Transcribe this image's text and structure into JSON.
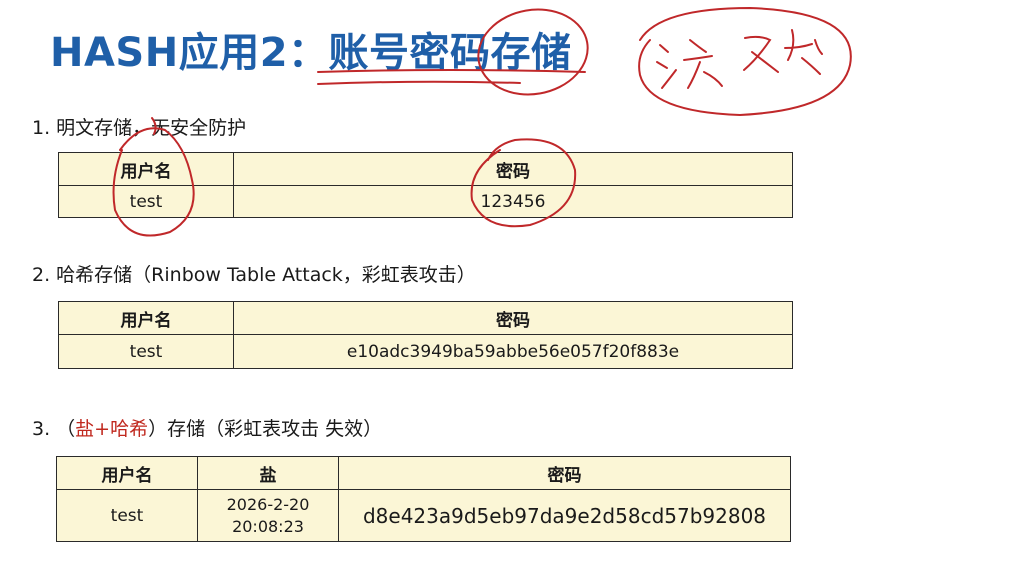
{
  "title": "HASH应用2：账号密码存储",
  "handwriting": "游戏",
  "sections": [
    {
      "heading": "1. 明文存储，无安全防护",
      "headers": [
        "用户名",
        "密码"
      ],
      "row": [
        "test",
        "123456"
      ]
    },
    {
      "heading": "2. 哈希存储（Rinbow Table Attack，彩虹表攻击）",
      "headers": [
        "用户名",
        "密码"
      ],
      "row": [
        "test",
        "e10adc3949ba59abbe56e057f20f883e"
      ]
    },
    {
      "heading_prefix": "3. （",
      "heading_highlight": "盐+哈希",
      "heading_suffix": "）存储（彩虹表攻击 失效）",
      "headers": [
        "用户名",
        "盐",
        "密码"
      ],
      "row": [
        "test",
        "2026-2-20",
        "20:08:23",
        "d8e423a9d5eb97da9e2d58cd57b92808"
      ]
    }
  ],
  "colors": {
    "title": "#1f5fa8",
    "highlight": "#c0281e",
    "table_bg": "#fbf6d6",
    "ink": "#c0282a"
  }
}
